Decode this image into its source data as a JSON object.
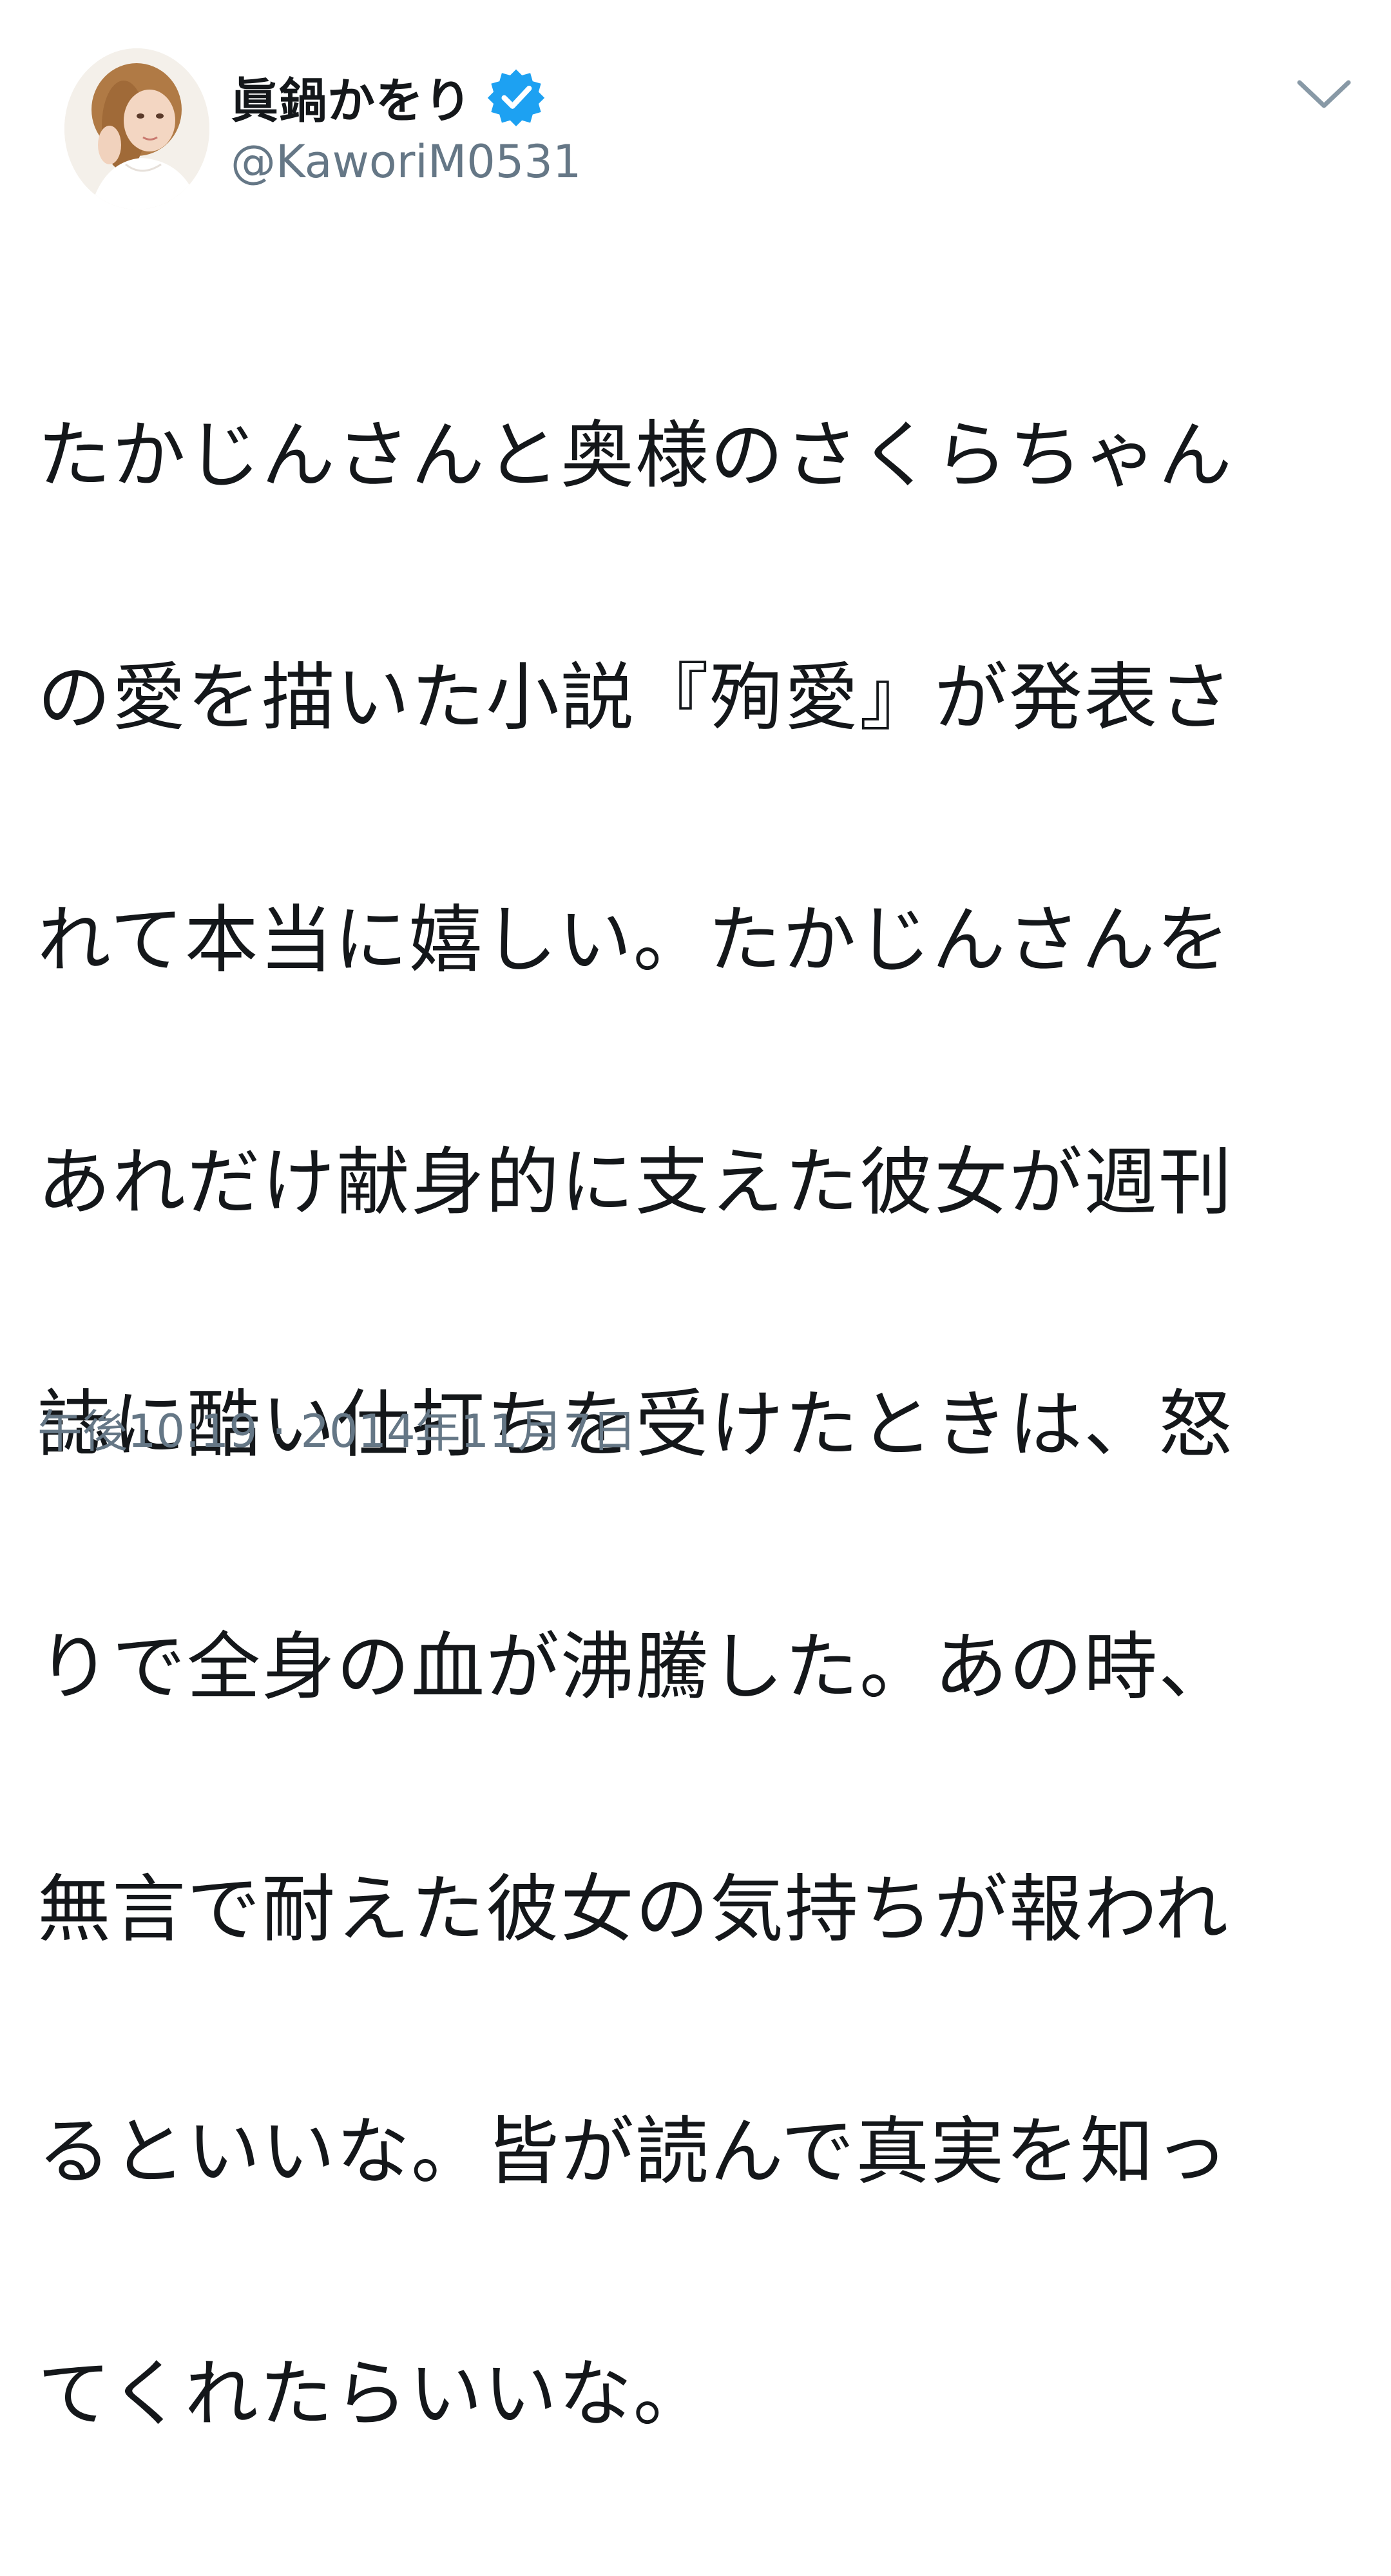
{
  "tweet": {
    "display_name": "眞鍋かをり",
    "handle": "@KaworiM0531",
    "text_lines": [
      "たかじんさんと奥様のさくらちゃん",
      "の愛を描いた小説『殉愛』が発表さ",
      "れて本当に嬉しい。たかじんさんを",
      "あれだけ献身的に支えた彼女が週刊",
      "誌に酷い仕打ちを受けたときは、怒",
      "りで全身の血が沸騰した。あの時、",
      "無言で耐えた彼女の気持ちが報われ",
      "るといいな。皆が読んで真実を知っ",
      "てくれたらいいな。"
    ],
    "timestamp": "午後10:19 · 2014年11月7日"
  },
  "icons": {
    "verified": "verified-badge-icon",
    "menu": "chevron-down-icon"
  },
  "colors": {
    "verified_blue": "#1da1f2",
    "secondary_text": "#657786",
    "primary_text": "#14171a"
  }
}
